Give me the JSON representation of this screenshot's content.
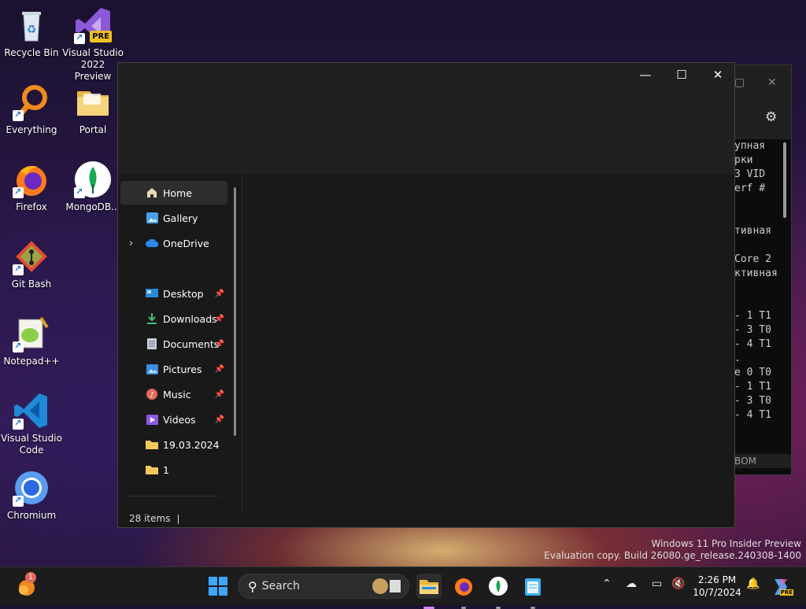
{
  "desktop": {
    "icons": [
      {
        "label": "Recycle Bin"
      },
      {
        "label": "Visual Studio 2022 Preview",
        "badge": "PRE"
      },
      {
        "label": "Everything"
      },
      {
        "label": "Portal"
      },
      {
        "label": "Firefox"
      },
      {
        "label": "MongoDB..."
      },
      {
        "label": "Git Bash"
      },
      {
        "label": "Notepad++"
      },
      {
        "label": "Visual Studio Code"
      },
      {
        "label": "Chromium"
      }
    ]
  },
  "terminal": {
    "lines": [
      "упная",
      "рки",
      "3 VID",
      "erf #",
      "",
      "",
      "тивная",
      "",
      "Core 2",
      "ктивная",
      "",
      "",
      "- 1 T1",
      "- 3 T0",
      "- 4 T1",
      ".",
      "e 0 T0",
      "- 1 T1",
      "- 3 T0",
      "- 4 T1"
    ],
    "bottom_text": "ВОМ"
  },
  "explorer": {
    "nav": [
      {
        "label": "Home",
        "icon": "home-icon"
      },
      {
        "label": "Gallery",
        "icon": "gallery-icon"
      },
      {
        "label": "OneDrive",
        "icon": "onedrive-icon"
      },
      {
        "label": "Desktop",
        "icon": "desktop-folder-icon"
      },
      {
        "label": "Downloads",
        "icon": "downloads-icon"
      },
      {
        "label": "Documents",
        "icon": "documents-icon"
      },
      {
        "label": "Pictures",
        "icon": "pictures-icon"
      },
      {
        "label": "Music",
        "icon": "music-icon"
      },
      {
        "label": "Videos",
        "icon": "videos-icon"
      },
      {
        "label": "19.03.2024",
        "icon": "folder-icon"
      },
      {
        "label": "1",
        "icon": "folder-icon"
      }
    ],
    "status": "28 items"
  },
  "watermark": {
    "line1": "Windows 11 Pro Insider Preview",
    "line2": "Evaluation copy. Build 26080.ge_release.240308-1400"
  },
  "taskbar": {
    "search_label": "Search",
    "notification_badge": "1",
    "time": "2:26 PM",
    "date": "10/7/2024",
    "copilot_badge": "PRE"
  },
  "colors": {
    "accent": "#0078d4",
    "folder": "#f4c85a"
  }
}
